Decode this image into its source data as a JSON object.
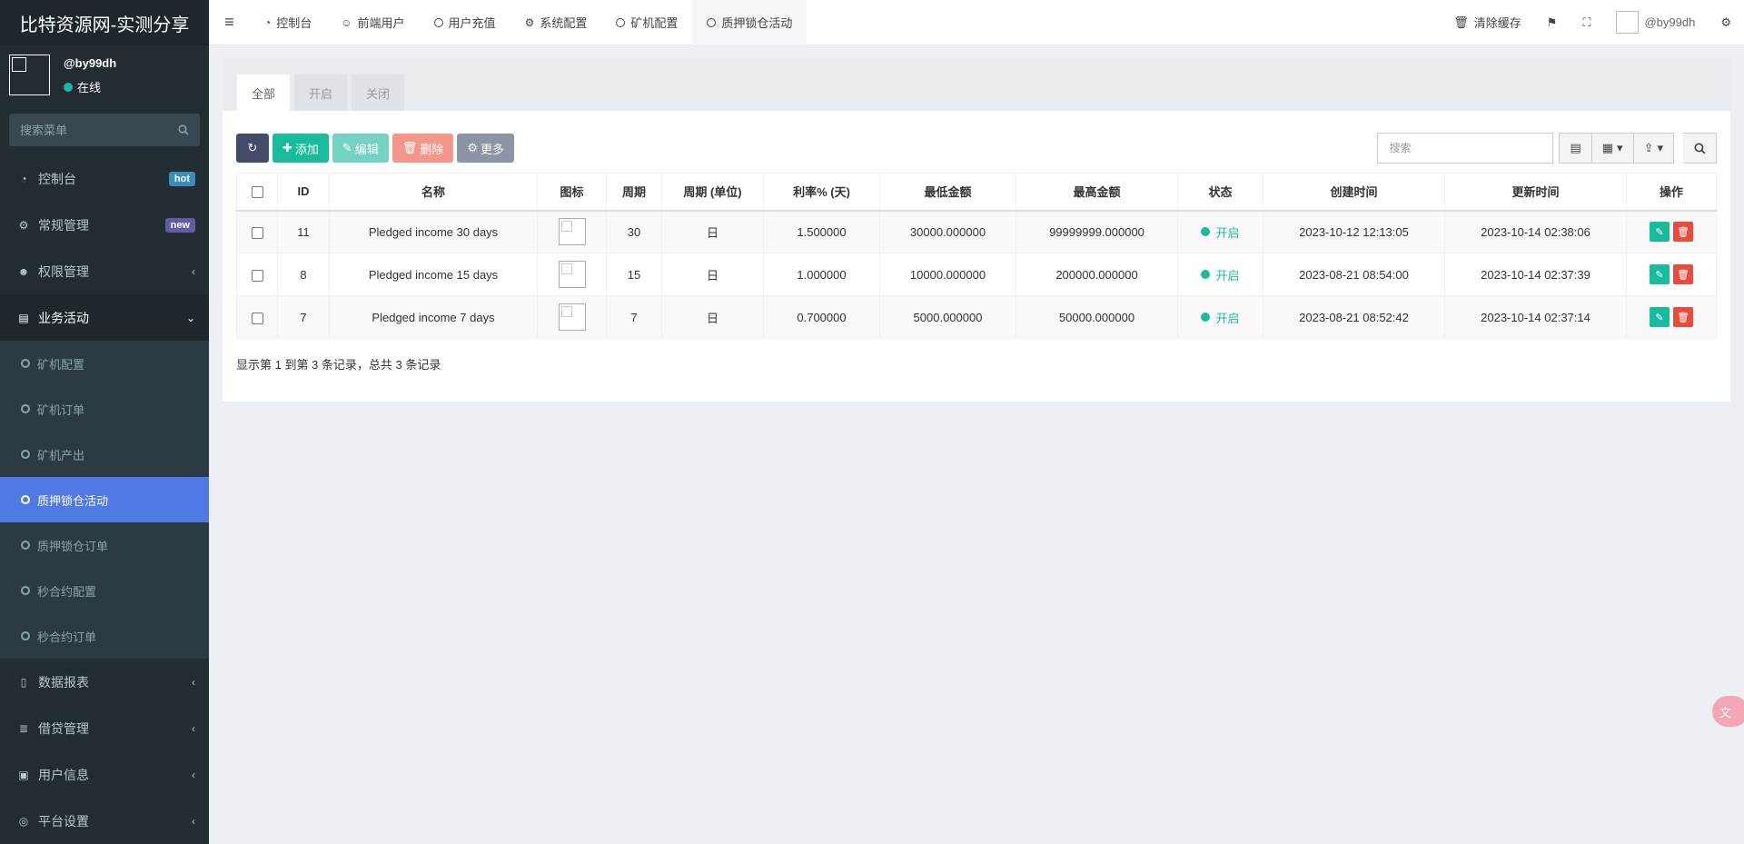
{
  "brand": "比特资源网-实测分享",
  "user": {
    "name": "@by99dh",
    "status": "在线"
  },
  "sidebar_search": {
    "placeholder": "搜索菜单"
  },
  "menu": [
    {
      "label": "控制台",
      "badge": "hot",
      "icon": "dashboard-icon"
    },
    {
      "label": "常规管理",
      "badge": "new",
      "icon": "cogs-icon"
    },
    {
      "label": "权限管理",
      "icon": "group-icon"
    },
    {
      "label": "业务活动",
      "icon": "newspaper-icon"
    },
    {
      "label": "数据报表",
      "icon": "file-icon"
    },
    {
      "label": "借贷管理",
      "icon": "list-icon"
    },
    {
      "label": "用户信息",
      "icon": "address-book-icon"
    },
    {
      "label": "平台设置",
      "icon": "settings-icon"
    }
  ],
  "submenu": [
    {
      "label": "矿机配置"
    },
    {
      "label": "矿机订单"
    },
    {
      "label": "矿机产出"
    },
    {
      "label": "质押锁仓活动",
      "active": true
    },
    {
      "label": "质押锁仓订单"
    },
    {
      "label": "秒合约配置"
    },
    {
      "label": "秒合约订单"
    }
  ],
  "topnav": {
    "tabs": [
      "控制台",
      "前端用户",
      "用户充值",
      "系统配置",
      "矿机配置",
      "质押锁仓活动"
    ],
    "clear_cache": "清除缓存",
    "username": "@by99dh"
  },
  "filter_tabs": [
    "全部",
    "开启",
    "关闭"
  ],
  "toolbar": {
    "add": "添加",
    "edit": "编辑",
    "delete": "删除",
    "more": "更多",
    "search_placeholder": "搜索"
  },
  "table": {
    "headers": [
      "ID",
      "名称",
      "图标",
      "周期",
      "周期 (单位)",
      "利率% (天)",
      "最低金额",
      "最高金额",
      "状态",
      "创建时间",
      "更新时间",
      "操作"
    ],
    "rows": [
      {
        "id": "11",
        "name": "Pledged income 30 days",
        "period": "30",
        "unit": "日",
        "rate": "1.500000",
        "min": "30000.000000",
        "max": "99999999.000000",
        "status": "开启",
        "created": "2023-10-12 12:13:05",
        "updated": "2023-10-14 02:38:06"
      },
      {
        "id": "8",
        "name": "Pledged income 15 days",
        "period": "15",
        "unit": "日",
        "rate": "1.000000",
        "min": "10000.000000",
        "max": "200000.000000",
        "status": "开启",
        "created": "2023-08-21 08:54:00",
        "updated": "2023-10-14 02:37:39"
      },
      {
        "id": "7",
        "name": "Pledged income 7 days",
        "period": "7",
        "unit": "日",
        "rate": "0.700000",
        "min": "5000.000000",
        "max": "50000.000000",
        "status": "开启",
        "created": "2023-08-21 08:52:42",
        "updated": "2023-10-14 02:37:14"
      }
    ]
  },
  "pagination_info": "显示第 1 到第 3 条记录，总共 3 条记录",
  "colors": {
    "sidebar_bg": "#222d32",
    "active": "#4f7ae3",
    "success": "#18bc9c",
    "danger": "#e74c3c"
  }
}
